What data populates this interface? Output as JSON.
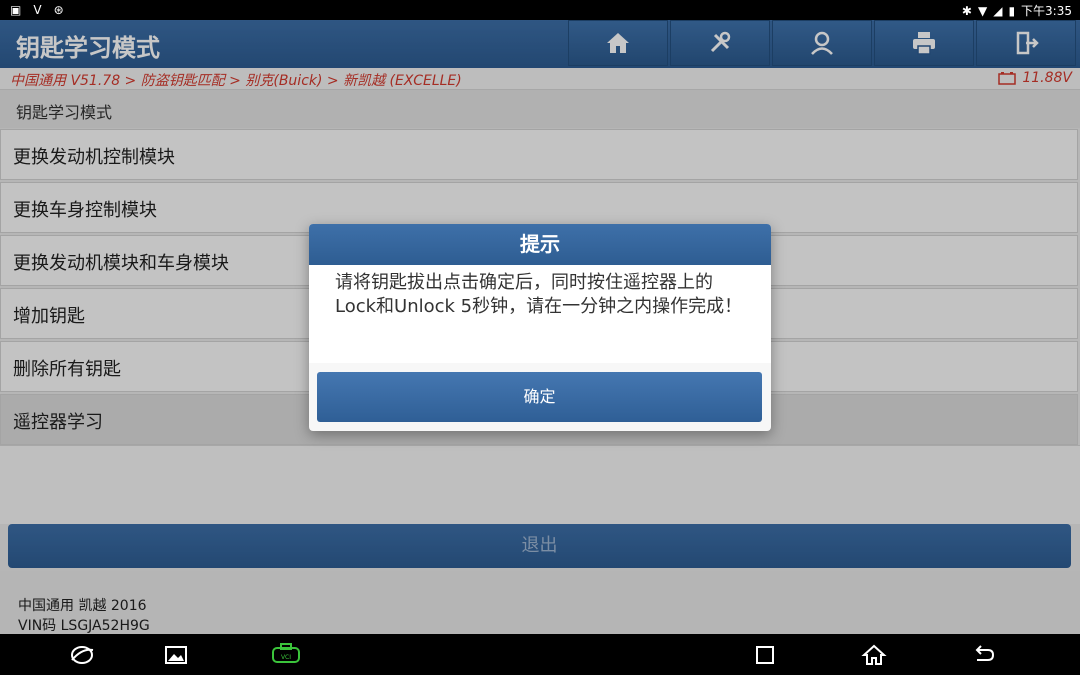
{
  "status_bar": {
    "time": "下午3:35"
  },
  "header": {
    "title": "钥匙学习模式",
    "toolbar": [
      "home-icon",
      "wrench-icon",
      "user-icon",
      "printer-icon",
      "exit-icon"
    ]
  },
  "breadcrumb": {
    "path": "中国通用 V51.78 > 防盗钥匙匹配 > 别克(Buick) > 新凯越 (EXCELLE)",
    "voltage": "11.88V"
  },
  "list": {
    "header": "钥匙学习模式",
    "items": [
      {
        "label": "更换发动机控制模块"
      },
      {
        "label": "更换车身控制模块"
      },
      {
        "label": "更换发动机模块和车身模块"
      },
      {
        "label": "增加钥匙"
      },
      {
        "label": "删除所有钥匙"
      },
      {
        "label": "遥控器学习"
      }
    ]
  },
  "exit_button": "退出",
  "footer": {
    "vehicle": "中国通用 凯越 2016",
    "vin": "VIN码 LSGJA52H9G"
  },
  "dialog": {
    "title": "提示",
    "message": "请将钥匙拔出点击确定后，同时按住遥控器上的Lock和Unlock 5秒钟，请在一分钟之内操作完成！",
    "confirm": "确定"
  },
  "colors": {
    "brand": "#2e5d92",
    "breadcrumb": "#d43a2f"
  }
}
